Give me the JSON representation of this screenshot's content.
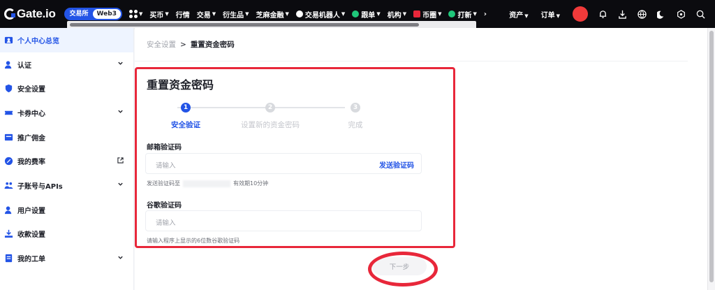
{
  "topbar": {
    "logo_text": "Gate.io",
    "seg": [
      "交易所",
      "Web3"
    ],
    "nav": [
      {
        "label": "买币",
        "caret": true
      },
      {
        "label": "行情",
        "caret": false
      },
      {
        "label": "交易",
        "caret": true
      },
      {
        "label": "衍生品",
        "caret": true
      },
      {
        "label": "芝麻金融",
        "caret": true
      },
      {
        "label": "交易机器人",
        "caret": true,
        "icon": "robot-icon"
      },
      {
        "label": "跟单",
        "caret": true,
        "icon": "leaf-icon"
      },
      {
        "label": "机构",
        "caret": true
      },
      {
        "label": "币圈",
        "caret": true,
        "icon": "news-icon"
      },
      {
        "label": "打新",
        "caret": true,
        "icon": "leaf-icon"
      }
    ],
    "more": "›",
    "right": {
      "assets": "资产",
      "orders": "订单"
    }
  },
  "sidebar": {
    "items": [
      {
        "label": "个人中心总览",
        "icon": "profile-icon",
        "active": true,
        "chevron": false,
        "external": false
      },
      {
        "label": "认证",
        "icon": "verify-icon",
        "active": false,
        "chevron": true,
        "external": false
      },
      {
        "label": "安全设置",
        "icon": "shield-icon",
        "active": false,
        "chevron": false,
        "external": false
      },
      {
        "label": "卡券中心",
        "icon": "ticket-icon",
        "active": false,
        "chevron": true,
        "external": false
      },
      {
        "label": "推广佣金",
        "icon": "commission-icon",
        "active": false,
        "chevron": false,
        "external": false
      },
      {
        "label": "我的费率",
        "icon": "percent-icon",
        "active": false,
        "chevron": false,
        "external": true
      },
      {
        "label": "子账号与APIs",
        "icon": "subaccount-icon",
        "active": false,
        "chevron": true,
        "external": false
      },
      {
        "label": "用户设置",
        "icon": "user-settings-icon",
        "active": false,
        "chevron": false,
        "external": false
      },
      {
        "label": "收款设置",
        "icon": "download-icon",
        "active": false,
        "chevron": false,
        "external": false
      },
      {
        "label": "我的工单",
        "icon": "ticket-list-icon",
        "active": false,
        "chevron": true,
        "external": false
      }
    ]
  },
  "breadcrumb": {
    "parent": "安全设置",
    "sep": ">",
    "current": "重置资金密码"
  },
  "panel": {
    "title": "重置资金密码",
    "steps": [
      {
        "num": "1",
        "label": "安全验证",
        "active": true
      },
      {
        "num": "2",
        "label": "设置新的资金密码",
        "active": false
      },
      {
        "num": "3",
        "label": "完成",
        "active": false
      }
    ],
    "email": {
      "label": "邮箱验证码",
      "placeholder": "请输入",
      "send": "发送验证码",
      "hint_prefix": "发送验证码至",
      "hint_suffix": "有效期10分钟"
    },
    "google": {
      "label": "谷歌验证码",
      "placeholder": "请输入",
      "hint": "请输入程序上显示的6位数谷歌验证码"
    }
  },
  "next_button": "下一步",
  "colors": {
    "accent": "#2354e6",
    "highlight": "#e8273a",
    "topbar": "#0b0b0f"
  }
}
